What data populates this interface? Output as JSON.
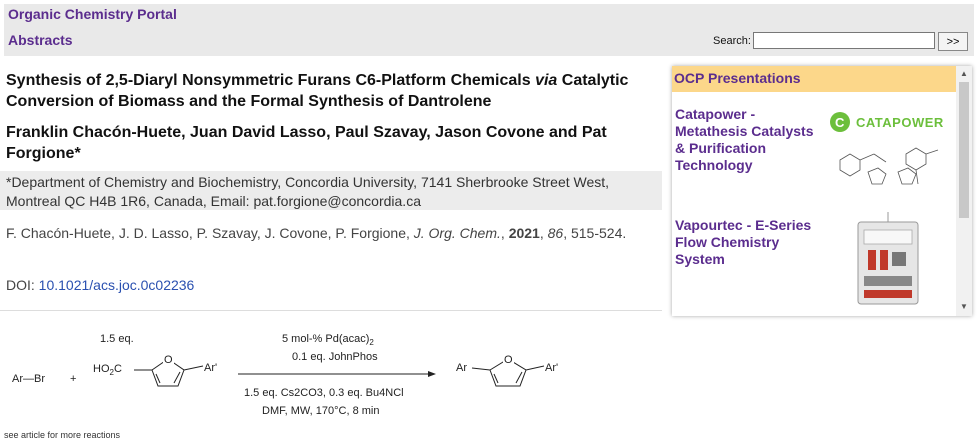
{
  "header": {
    "portal": "Organic Chemistry Portal",
    "section": "Abstracts",
    "search_label": "Search:",
    "search_value": "",
    "search_button": ">>"
  },
  "article": {
    "title_pre": "Synthesis of 2,5-Diaryl Nonsymmetric Furans C6-Platform Chemicals ",
    "title_italic": "via",
    "title_post": " Catalytic Conversion of Biomass and the Formal Synthesis of Dantrolene",
    "authors": "Franklin Chacón-Huete, Juan David Lasso, Paul Szavay, Jason Covone and Pat Forgione*",
    "affiliation": "*Department of Chemistry and Biochemistry, Concordia University, 7141 Sherbrooke Street West, Montreal QC H4B 1R6, Canada, Email: pat.forgione@concordia.ca",
    "citation_authors": "F. Chacón-Huete, J. D. Lasso, P. Szavay, J. Covone, P. Forgione, ",
    "journal": "J. Org. Chem.",
    "year": "2021",
    "volume": "86",
    "pages": "515-524.",
    "doi_label": "DOI: ",
    "doi": "10.1021/acs.joc.0c02236"
  },
  "scheme": {
    "reactant1": "Ar—Br",
    "plus": "+",
    "eq": "1.5 eq.",
    "acid_prefix": "HO",
    "acid_sub": "2",
    "acid_suffix": "C",
    "ar_prime": "Ar'",
    "o": "O",
    "ar": "Ar",
    "cond1_prefix": "5 mol-% Pd(acac)",
    "cond1_sub": "2",
    "cond2": "0.1 eq. JohnPhos",
    "cond3": "1.5 eq. Cs2CO3, 0.3 eq. Bu4NCl",
    "cond4": "DMF, MW, 170°C, 8 min"
  },
  "see_more": "see article for more reactions",
  "ocp": {
    "header": "OCP Presentations",
    "ads": [
      {
        "title": "Catapower - Metathesis Catalysts & Purification Technology",
        "logo": "CATAPOWER"
      },
      {
        "title": "Vapourtec - E-Series Flow Chemistry System"
      }
    ]
  },
  "colors": {
    "purple": "#5b2d8e",
    "ocp_header_bg": "#fcd78a",
    "link": "#2a50b0",
    "catapower_green": "#6cbf3c"
  }
}
